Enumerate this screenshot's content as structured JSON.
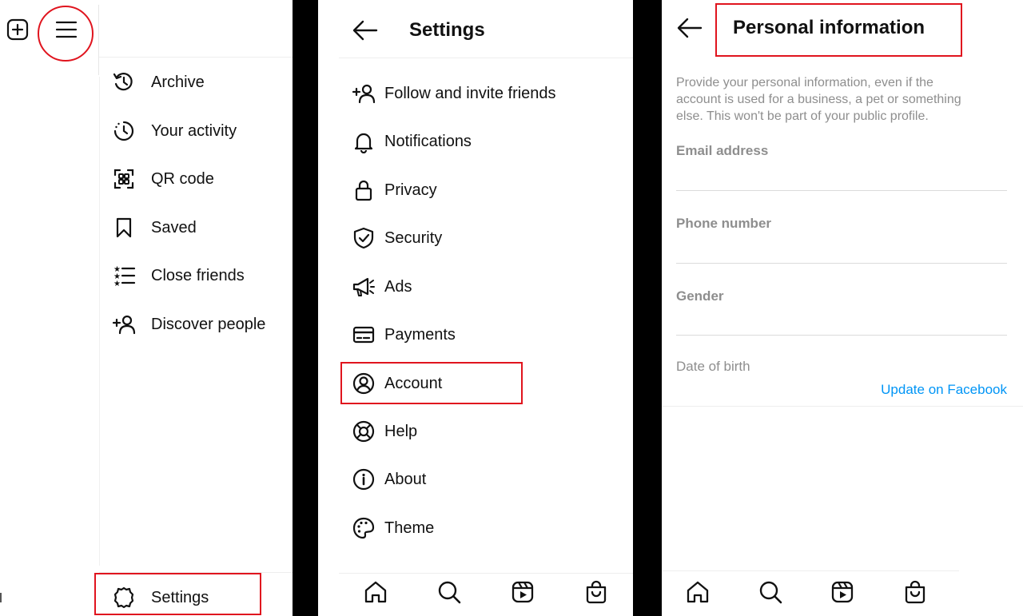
{
  "panel1": {
    "menu": [
      {
        "label": "Archive",
        "icon": "archive-icon"
      },
      {
        "label": "Your activity",
        "icon": "activity-icon"
      },
      {
        "label": "QR code",
        "icon": "qr-code-icon"
      },
      {
        "label": "Saved",
        "icon": "bookmark-icon"
      },
      {
        "label": "Close friends",
        "icon": "close-friends-icon"
      },
      {
        "label": "Discover people",
        "icon": "add-person-icon"
      }
    ],
    "settings_label": "Settings"
  },
  "panel2": {
    "title": "Settings",
    "items": [
      {
        "label": "Follow and invite friends",
        "icon": "add-person-icon"
      },
      {
        "label": "Notifications",
        "icon": "bell-icon"
      },
      {
        "label": "Privacy",
        "icon": "lock-icon"
      },
      {
        "label": "Security",
        "icon": "shield-icon"
      },
      {
        "label": "Ads",
        "icon": "megaphone-icon"
      },
      {
        "label": "Payments",
        "icon": "card-icon"
      },
      {
        "label": "Account",
        "icon": "account-icon"
      },
      {
        "label": "Help",
        "icon": "help-icon"
      },
      {
        "label": "About",
        "icon": "info-icon"
      },
      {
        "label": "Theme",
        "icon": "palette-icon"
      }
    ]
  },
  "panel3": {
    "title": "Personal information",
    "description": "Provide your personal information, even if the account is used for a business, a pet or something else. This won't be part of your public profile.",
    "description_lines": [
      "Provide your personal information, even if the",
      "account is used for a business, a pet or something",
      "else. This won't be part of your public profile."
    ],
    "fields": {
      "email": "Email address",
      "phone": "Phone number",
      "gender": "Gender",
      "dob": "Date of birth"
    },
    "update_link": "Update on Facebook"
  },
  "colors": {
    "accent_red": "#e0141e",
    "link_blue": "#0095f6",
    "muted_text": "#8e8e8e"
  }
}
